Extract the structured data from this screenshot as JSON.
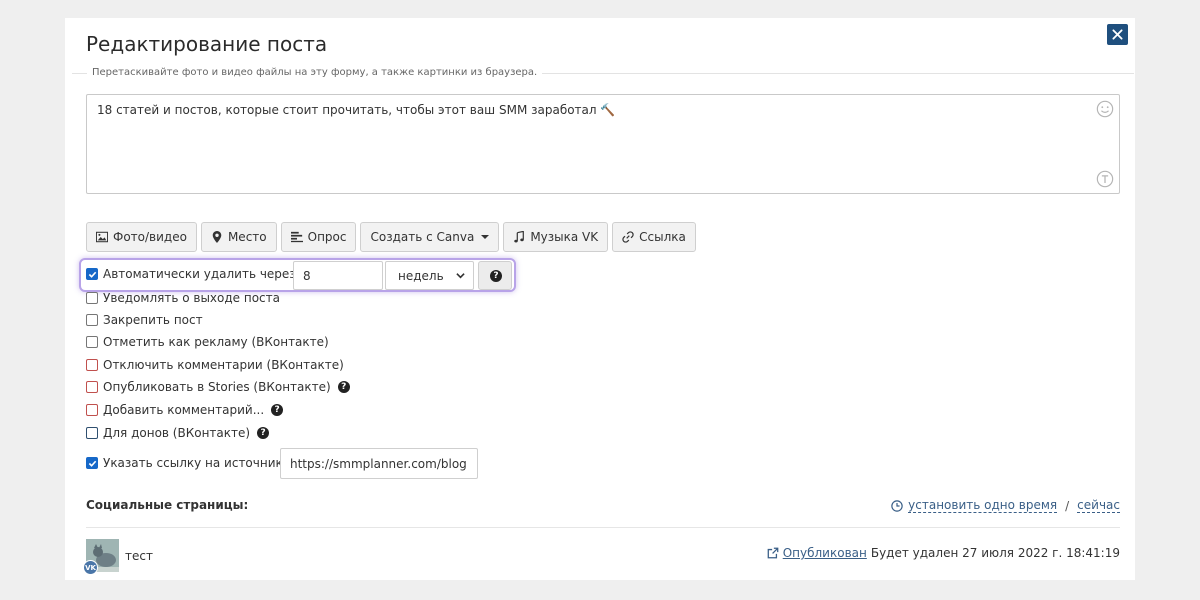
{
  "modal": {
    "title": "Редактирование поста",
    "hint": "Перетаскивайте фото и видео файлы на эту форму, а также картинки из браузера.",
    "close_icon": "close-icon"
  },
  "editor": {
    "text": "18 статей и постов, которые стоит прочитать, чтобы этот ваш SMM заработал 🔨"
  },
  "toolbar": {
    "photo_label": "Фото/видео",
    "place_label": "Место",
    "poll_label": "Опрос",
    "canva_label": "Создать с Canva",
    "music_label": "Музыка VK",
    "link_label": "Ссылка"
  },
  "options": {
    "auto_delete": {
      "label": "Автоматически удалить через",
      "checked": true,
      "value": "8",
      "unit": "недель"
    },
    "notify_label": "Уведомлять о выходе поста",
    "pin_label": "Закрепить пост",
    "ad_label": "Отметить как рекламу (ВКонтакте)",
    "disable_comments_label": "Отключить комментарии (ВКонтакте)",
    "stories_label": "Опубликовать в Stories (ВКонтакте)",
    "add_comment_label": "Добавить комментарий...",
    "donors_label": "Для донов (ВКонтакте)",
    "source": {
      "label": "Указать ссылку на источник",
      "checked": true,
      "value": "https://smmplanner.com/blog"
    }
  },
  "social": {
    "title": "Социальные страницы:",
    "set_one_time": "установить одно время",
    "separator": "/",
    "now": "сейчас",
    "account": {
      "name": "тест",
      "network_badge": "VK",
      "status_link": "Опубликован",
      "status_text": "Будет удален 27 июля 2022 г. 18:41:19"
    }
  },
  "colors": {
    "accent": "#1f4f7e",
    "link": "#3a5f87",
    "checkbox": "#1668c8",
    "highlight": "#b8a3e8"
  }
}
